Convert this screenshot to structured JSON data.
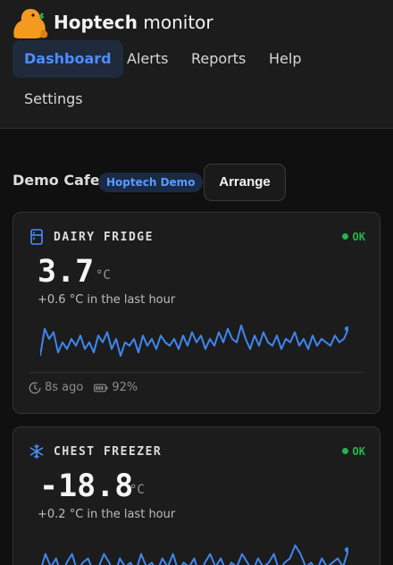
{
  "app": {
    "brand_bold": "Hoptech",
    "brand_rest": "monitor",
    "logo_icon": "beaver-logo-icon"
  },
  "nav": {
    "items": [
      {
        "label": "Dashboard",
        "active": true
      },
      {
        "label": "Alerts",
        "active": false
      },
      {
        "label": "Reports",
        "active": false
      },
      {
        "label": "Help",
        "active": false
      },
      {
        "label": "Settings",
        "active": false
      }
    ]
  },
  "site": {
    "name": "Demo Cafe",
    "org_badge": "Hoptech Demo",
    "arrange_label": "Arrange"
  },
  "colors": {
    "accent": "#4d8cff",
    "ok": "#27b34a",
    "chart_line": "#3f86f0"
  },
  "sensors": [
    {
      "name": "DAIRY FRIDGE",
      "icon": "fridge-icon",
      "status": "OK",
      "reading": "3.7",
      "unit": "°C",
      "delta": "+0.6 °C in the last hour",
      "last_seen": "8s ago",
      "battery": "92%",
      "trend": [
        3.1,
        3.9,
        3.6,
        3.8,
        3.2,
        3.5,
        3.3,
        3.6,
        3.4,
        3.7,
        3.3,
        3.5,
        3.2,
        3.7,
        3.5,
        3.8,
        3.3,
        3.6,
        3.1,
        3.5,
        3.4,
        3.6,
        3.2,
        3.7,
        3.4,
        3.6,
        3.3,
        3.7,
        3.5,
        3.4,
        3.6,
        3.3,
        3.7,
        3.4,
        3.8,
        3.5,
        3.7,
        3.3,
        3.6,
        3.4,
        3.8,
        3.5,
        3.9,
        3.6,
        3.5,
        4.0,
        3.6,
        3.3,
        3.7,
        3.4,
        3.8,
        3.5,
        3.4,
        3.7,
        3.3,
        3.6,
        3.5,
        3.8,
        3.4,
        3.6,
        3.3,
        3.7,
        3.4,
        3.6,
        3.5,
        3.4,
        3.7,
        3.5,
        3.6,
        3.9
      ]
    },
    {
      "name": "CHEST FREEZER",
      "icon": "snowflake-icon",
      "status": "OK",
      "reading": "-18.8",
      "unit": "°C",
      "delta": "+0.2 °C in the last hour",
      "last_seen": "",
      "battery": "",
      "trend": [
        -19.0,
        -18.6,
        -18.9,
        -18.7,
        -19.1,
        -18.8,
        -18.6,
        -19.0,
        -18.8,
        -18.7,
        -19.0,
        -18.9,
        -18.6,
        -18.8,
        -19.1,
        -18.7,
        -18.9,
        -18.8,
        -19.0,
        -18.6,
        -18.9,
        -18.8,
        -19.0,
        -18.7,
        -18.9,
        -18.6,
        -19.0,
        -18.8,
        -18.9,
        -18.7,
        -19.1,
        -18.8,
        -18.6,
        -18.9,
        -18.7,
        -19.0,
        -18.8,
        -18.9,
        -18.6,
        -18.8,
        -19.0,
        -18.7,
        -18.9,
        -18.8,
        -18.6,
        -19.0,
        -18.8,
        -18.7,
        -18.4,
        -18.6,
        -18.9,
        -18.8,
        -19.0,
        -18.7,
        -18.9,
        -18.8,
        -18.7,
        -18.9,
        -18.5
      ]
    }
  ]
}
